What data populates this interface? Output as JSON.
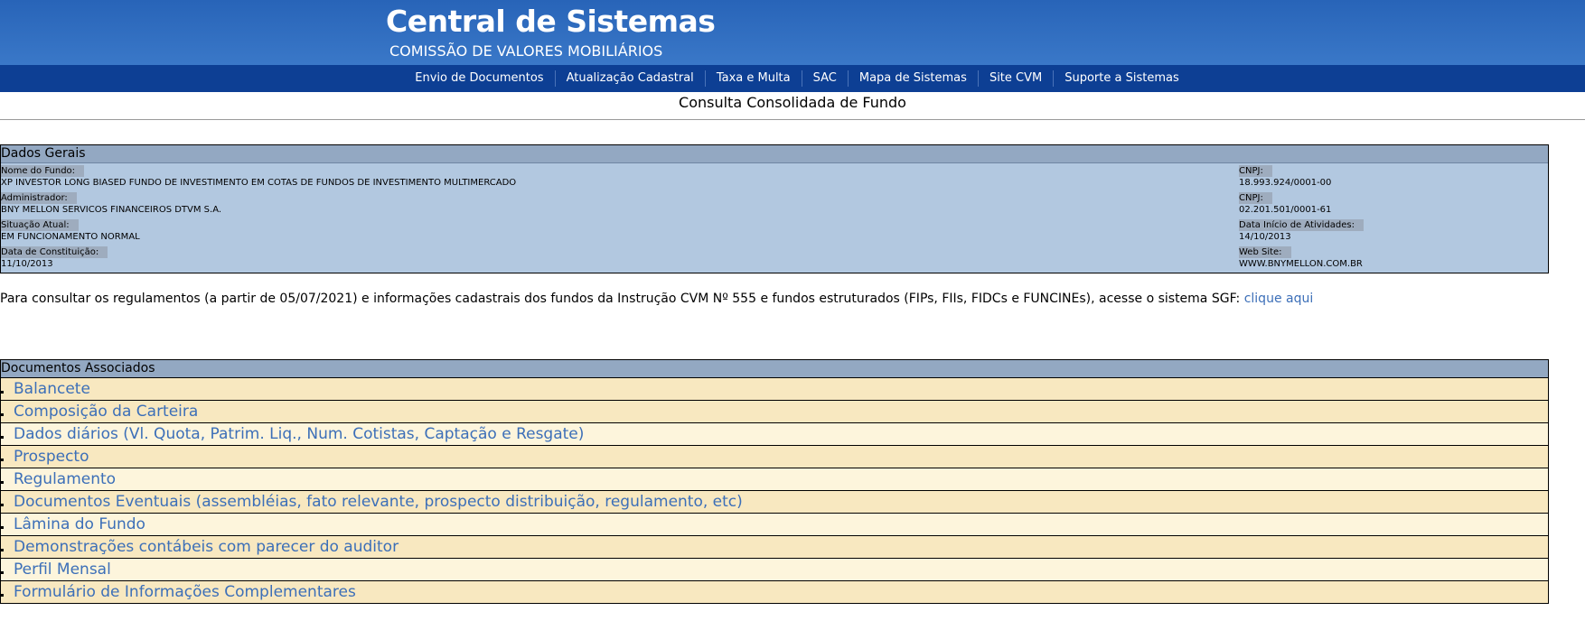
{
  "header": {
    "title": "Central de Sistemas",
    "subtitle": "COMISSÃO DE VALORES MOBILIÁRIOS"
  },
  "nav": {
    "items": [
      {
        "label": "Envio de Documentos"
      },
      {
        "label": "Atualização Cadastral"
      },
      {
        "label": "Taxa e Multa"
      },
      {
        "label": "SAC"
      },
      {
        "label": "Mapa de Sistemas"
      },
      {
        "label": "Site CVM"
      },
      {
        "label": "Suporte a Sistemas"
      }
    ]
  },
  "page": {
    "title": "Consulta Consolidada de Fundo"
  },
  "dados_gerais": {
    "heading": "Dados Gerais",
    "nome_label": "Nome do Fundo:",
    "nome_value": "XP INVESTOR LONG BIASED FUNDO DE INVESTIMENTO EM COTAS DE FUNDOS DE INVESTIMENTO MULTIMERCADO",
    "administrador_label": "Administrador:",
    "administrador_value": "BNY MELLON SERVICOS FINANCEIROS DTVM S.A.",
    "situacao_label": "Situação Atual:",
    "situacao_value": "EM FUNCIONAMENTO NORMAL",
    "constituicao_label": "Data de Constituição:",
    "constituicao_value": "11/10/2013",
    "cnpj_fundo_label": "CNPJ:",
    "cnpj_fundo_value": "18.993.924/0001-00",
    "cnpj_admin_label": "CNPJ:",
    "cnpj_admin_value": "02.201.501/0001-61",
    "inicio_label": "Data Início de Atividades:",
    "inicio_value": "14/10/2013",
    "website_label": "Web Site:",
    "website_value": "WWW.BNYMELLON.COM.BR"
  },
  "info": {
    "text": "Para consultar os regulamentos (a partir de 05/07/2021) e informações cadastrais dos fundos da Instrução CVM Nº 555 e fundos estruturados (FIPs, FIIs, FIDCs e FUNCINEs), acesse o sistema SGF: ",
    "link": "clique aqui"
  },
  "documentos": {
    "heading": "Documentos Associados",
    "items": [
      {
        "label": "Balancete"
      },
      {
        "label": "Composição da Carteira"
      },
      {
        "label": "Dados diários (Vl. Quota, Patrim. Liq., Num. Cotistas, Captação e Resgate)"
      },
      {
        "label": "Prospecto"
      },
      {
        "label": "Regulamento"
      },
      {
        "label": "Documentos Eventuais (assembléias, fato relevante, prospecto distribuição, regulamento, etc)"
      },
      {
        "label": "Lâmina do Fundo"
      },
      {
        "label": "Demonstrações contábeis com parecer do auditor"
      },
      {
        "label": "Perfil Mensal"
      },
      {
        "label": "Formulário de Informações Complementares"
      }
    ]
  },
  "colors": {
    "banner": "#3a78c8",
    "navbar": "#0d3f94",
    "panel_bg": "#b2c8e0",
    "link": "#3c6fb8",
    "row_odd": "#f8e8c0",
    "row_even": "#fdf5dc"
  }
}
